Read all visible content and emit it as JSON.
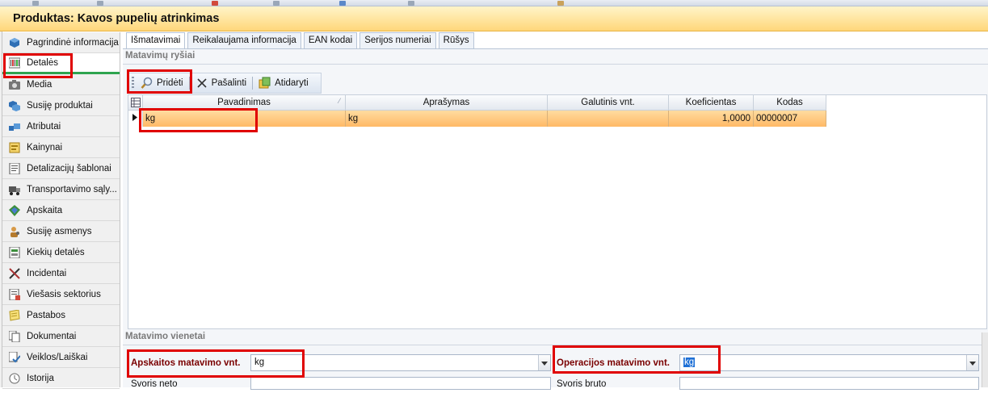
{
  "window": {
    "title": "Produktas: Kavos pupelių atrinkimas"
  },
  "sidebar": {
    "items": [
      {
        "label": "Pagrindinė informacija",
        "icon": "cube-icon"
      },
      {
        "label": "Detalės",
        "icon": "barcode-icon"
      },
      {
        "label": "Media",
        "icon": "camera-icon"
      },
      {
        "label": "Susiję produktai",
        "icon": "linked-cubes-icon"
      },
      {
        "label": "Atributai",
        "icon": "attributes-icon"
      },
      {
        "label": "Kainynai",
        "icon": "price-list-icon"
      },
      {
        "label": "Detalizacijų šablonai",
        "icon": "template-icon"
      },
      {
        "label": "Transportavimo sąly...",
        "icon": "truck-icon"
      },
      {
        "label": "Apskaita",
        "icon": "accounting-icon"
      },
      {
        "label": "Susiję asmenys",
        "icon": "person-icon"
      },
      {
        "label": "Kiekių detalės",
        "icon": "quantity-icon"
      },
      {
        "label": "Incidentai",
        "icon": "tools-icon"
      },
      {
        "label": "Viešasis sektorius",
        "icon": "public-sector-icon"
      },
      {
        "label": "Pastabos",
        "icon": "notes-icon"
      },
      {
        "label": "Dokumentai",
        "icon": "documents-icon"
      },
      {
        "label": "Veiklos/Laiškai",
        "icon": "activity-icon"
      },
      {
        "label": "Istorija",
        "icon": "history-icon"
      }
    ],
    "selected_index": 1
  },
  "tabs": [
    {
      "label": "Išmatavimai",
      "active": true
    },
    {
      "label": "Reikalaujama informacija"
    },
    {
      "label": "EAN kodai"
    },
    {
      "label": "Serijos numeriai"
    },
    {
      "label": "Rūšys"
    }
  ],
  "section1": {
    "title": "Matavimų ryšiai"
  },
  "toolbar": {
    "add_label": "Pridėti",
    "remove_label": "Pašalinti",
    "open_label": "Atidaryti"
  },
  "grid": {
    "columns": [
      "Pavadinimas",
      "Aprašymas",
      "Galutinis vnt.",
      "Koeficientas",
      "Kodas"
    ],
    "rows": [
      {
        "name": "kg",
        "description": "kg",
        "final_unit": "",
        "coefficient": "1,0000",
        "code": "00000007"
      }
    ]
  },
  "section2": {
    "title": "Matavimo vienetai"
  },
  "form": {
    "accounting_unit_label": "Apskaitos matavimo vnt.",
    "accounting_unit_value": "kg",
    "operation_unit_label": "Operacijos matavimo vnt.",
    "operation_unit_value": "kg",
    "net_weight_label": "Svoris neto",
    "gross_weight_label": "Svoris bruto"
  },
  "colors": {
    "title_bar": "#ffd77a",
    "selected_row": "#ffb966",
    "highlight_box": "#e00000",
    "required_label": "#7a0000",
    "selected_indicator": "#2ea44f"
  }
}
